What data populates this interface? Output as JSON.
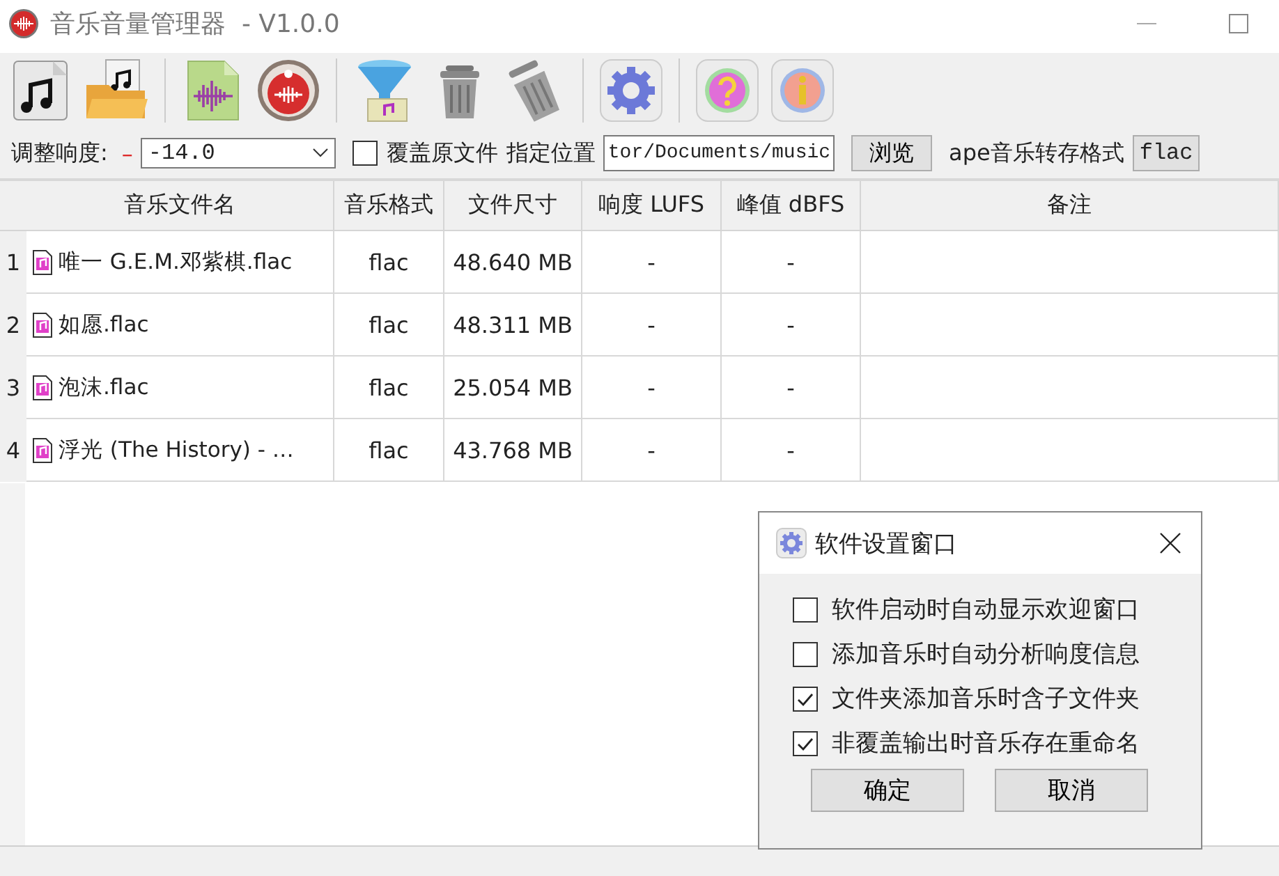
{
  "window": {
    "title": "音乐音量管理器  - V1.0.0"
  },
  "options": {
    "loudness_label": "调整响度:",
    "loudness_mark": "–",
    "loudness_value": "-14.0",
    "overwrite": {
      "label": "覆盖原文件",
      "checked": false
    },
    "location_label": "指定位置",
    "location_value": "tor/Documents/music",
    "browse_button": "浏览",
    "ape_label": "ape音乐转存格式",
    "ape_value": "flac"
  },
  "table": {
    "columns": [
      "音乐文件名",
      "音乐格式",
      "文件尺寸",
      "响度 LUFS",
      "峰值 dBFS",
      "备注"
    ],
    "rows": [
      {
        "number": "1",
        "name": "唯一 G.E.M.邓紫棋.flac",
        "format": "flac",
        "size": "48.640 MB",
        "lufs": "-",
        "peak": "-"
      },
      {
        "number": "2",
        "name": "如愿.flac",
        "format": "flac",
        "size": "48.311 MB",
        "lufs": "-",
        "peak": "-"
      },
      {
        "number": "3",
        "name": "泡沫.flac",
        "format": "flac",
        "size": "25.054 MB",
        "lufs": "-",
        "peak": "-"
      },
      {
        "number": "4",
        "name": "浮光 (The History) - …",
        "format": "flac",
        "size": "43.768 MB",
        "lufs": "-",
        "peak": "-"
      }
    ]
  },
  "dialog": {
    "title": "软件设置窗口",
    "options": [
      {
        "label": "软件启动时自动显示欢迎窗口",
        "checked": false
      },
      {
        "label": "添加音乐时自动分析响度信息",
        "checked": false
      },
      {
        "label": "文件夹添加音乐时含子文件夹",
        "checked": true
      },
      {
        "label": "非覆盖输出时音乐存在重命名",
        "checked": true
      }
    ],
    "buttons": [
      "确定",
      "取消"
    ]
  }
}
